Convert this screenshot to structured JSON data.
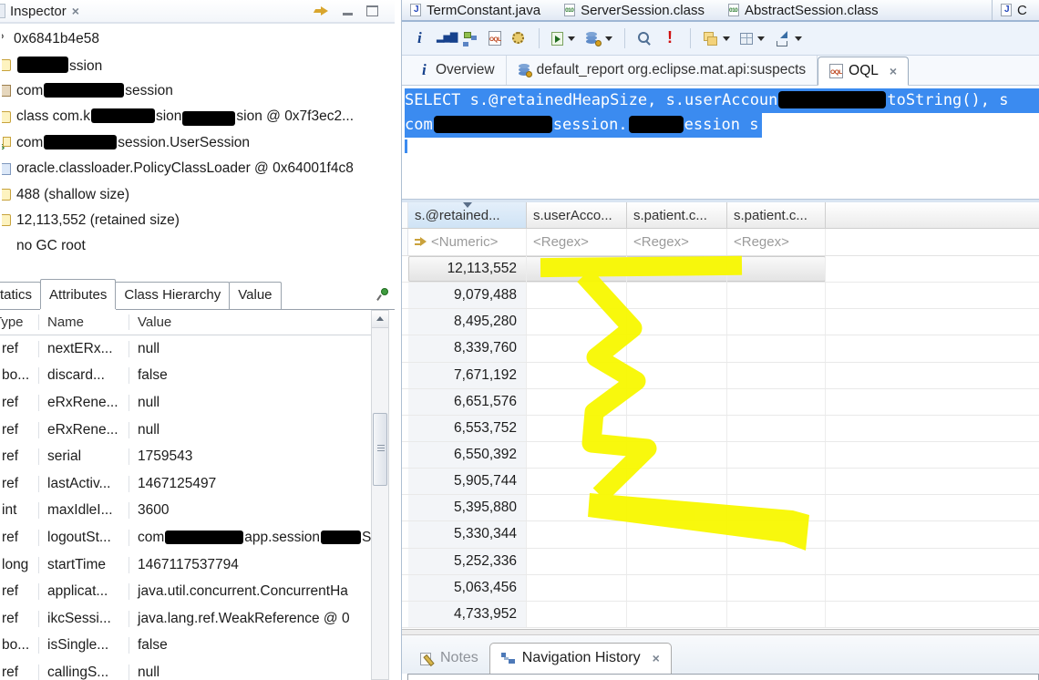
{
  "colors": {
    "selection_blue": "#3b8bf0",
    "highlighter_yellow": "#f8f800",
    "redaction_black": "#000000"
  },
  "inspector": {
    "title": "Inspector",
    "items": [
      {
        "icon": "clipped-question",
        "segments": [
          {
            "t": "0x6841b4e58"
          }
        ]
      },
      {
        "icon": "object",
        "segments": [
          {
            "r": [
              56,
              18
            ]
          },
          {
            "t": "ssion"
          }
        ]
      },
      {
        "icon": "field",
        "segments": [
          {
            "t": "com"
          },
          {
            "r": [
              88,
              16
            ]
          },
          {
            "t": "session"
          }
        ]
      },
      {
        "icon": "class",
        "segments": [
          {
            "t": "class com.k"
          },
          {
            "r": [
              70,
              16
            ]
          },
          {
            "t": "sion"
          },
          {
            "r": [
              58,
              16,
              6
            ]
          },
          {
            "t": "sion @ 0x7f3ec2..."
          }
        ]
      },
      {
        "icon": "static-session",
        "segments": [
          {
            "t": "com"
          },
          {
            "r": [
              80,
              16
            ]
          },
          {
            "t": "session.UserSession"
          }
        ]
      },
      {
        "icon": "classloader",
        "segments": [
          {
            "t": "oracle.classloader.PolicyClassLoader @ 0x64001f4c8"
          }
        ]
      },
      {
        "icon": "shallow-size",
        "segments": [
          {
            "t": "488 (shallow size)"
          }
        ]
      },
      {
        "icon": "retained-size",
        "segments": [
          {
            "t": "12,113,552 (retained size)"
          }
        ]
      },
      {
        "icon": "none",
        "segments": [
          {
            "t": "no GC root"
          }
        ]
      }
    ],
    "tabs": {
      "statics": "Statics",
      "attributes": "Attributes",
      "class_hierarchy": "Class Hierarchy",
      "value": "Value"
    },
    "attr_table": {
      "headers": {
        "type": "Type",
        "name": "Name",
        "value": "Value"
      },
      "rows": [
        {
          "type": "ref",
          "name": "nextERx...",
          "value": [
            {
              "t": "null"
            }
          ]
        },
        {
          "type": "bo...",
          "name": "discard...",
          "value": [
            {
              "t": "false"
            }
          ]
        },
        {
          "type": "ref",
          "name": "eRxRene...",
          "value": [
            {
              "t": "null"
            }
          ]
        },
        {
          "type": "ref",
          "name": "eRxRene...",
          "value": [
            {
              "t": "null"
            }
          ]
        },
        {
          "type": "ref",
          "name": "serial",
          "value": [
            {
              "t": "1759543"
            }
          ]
        },
        {
          "type": "ref",
          "name": "lastActiv...",
          "value": [
            {
              "t": "1467125497"
            }
          ]
        },
        {
          "type": "int",
          "name": "maxIdleI...",
          "value": [
            {
              "t": "3600"
            }
          ]
        },
        {
          "type": "ref",
          "name": "logoutSt...",
          "value": [
            {
              "t": "com"
            },
            {
              "r": [
                86,
                15
              ]
            },
            {
              "t": "app.session"
            },
            {
              "r": [
                44,
                15
              ]
            },
            {
              "t": "Se"
            }
          ]
        },
        {
          "type": "long",
          "name": "startTime",
          "value": [
            {
              "t": "1467117537794"
            }
          ]
        },
        {
          "type": "ref",
          "name": "applicat...",
          "value": [
            {
              "t": "java.util.concurrent.ConcurrentHa"
            }
          ]
        },
        {
          "type": "ref",
          "name": "ikcSessi...",
          "value": [
            {
              "t": "java.lang.ref.WeakReference @ 0"
            }
          ]
        },
        {
          "type": "bo...",
          "name": "isSingle...",
          "value": [
            {
              "t": "false"
            }
          ]
        },
        {
          "type": "ref",
          "name": "callingS...",
          "value": [
            {
              "t": "null"
            }
          ]
        }
      ]
    }
  },
  "editor_tabs": [
    {
      "label": "TermConstant.java",
      "icon": "java-file"
    },
    {
      "label": "ServerSession.class",
      "icon": "class-file"
    },
    {
      "label": "AbstractSession.class",
      "icon": "class-file"
    },
    {
      "label": "C",
      "icon": "java-file",
      "clipped": true
    }
  ],
  "toolbar": {
    "items": [
      {
        "icon": "info"
      },
      {
        "icon": "histogram"
      },
      {
        "icon": "dominator-tree"
      },
      {
        "icon": "oql"
      },
      {
        "icon": "settings"
      },
      {
        "sep": true
      },
      {
        "icon": "run-report",
        "dropdown": true
      },
      {
        "icon": "heap-objects",
        "dropdown": true
      },
      {
        "sep": true
      },
      {
        "icon": "search"
      },
      {
        "icon": "leak-suspects"
      },
      {
        "sep": true
      },
      {
        "icon": "group-objects",
        "dropdown": true
      },
      {
        "icon": "calculator",
        "dropdown": true
      },
      {
        "icon": "export",
        "dropdown": true
      }
    ]
  },
  "view_tabs": {
    "overview": "Overview",
    "default_report": "default_report org.eclipse.mat.api:suspects",
    "oql": "OQL"
  },
  "query": {
    "lines": [
      [
        {
          "t": "SELECT s.@retainedHeapSize, s.userAccoun"
        },
        {
          "r": [
            118,
            19
          ]
        },
        {
          "t": "toString(), s"
        }
      ],
      [
        {
          "t": "com"
        },
        {
          "r": [
            130,
            19
          ]
        },
        {
          "t": "session."
        },
        {
          "r": [
            60,
            19
          ]
        },
        {
          "t": "ession s"
        }
      ]
    ]
  },
  "results": {
    "columns": [
      "s.@retained...",
      "s.userAcco...",
      "s.patient.c...",
      "s.patient.c..."
    ],
    "filters": [
      "<Numeric>",
      "<Regex>",
      "<Regex>",
      "<Regex>"
    ],
    "rows": [
      "12,113,552",
      "9,079,488",
      "8,495,280",
      "8,339,760",
      "7,671,192",
      "6,651,576",
      "6,553,752",
      "6,550,392",
      "5,905,744",
      "5,395,880",
      "5,330,344",
      "5,252,336",
      "5,063,456",
      "4,733,952"
    ],
    "selected_row_index": 0,
    "sorted_column_index": 0,
    "sort_direction": "descending"
  },
  "bottom_tabs": {
    "notes": "Notes",
    "nav_history": "Navigation History"
  }
}
